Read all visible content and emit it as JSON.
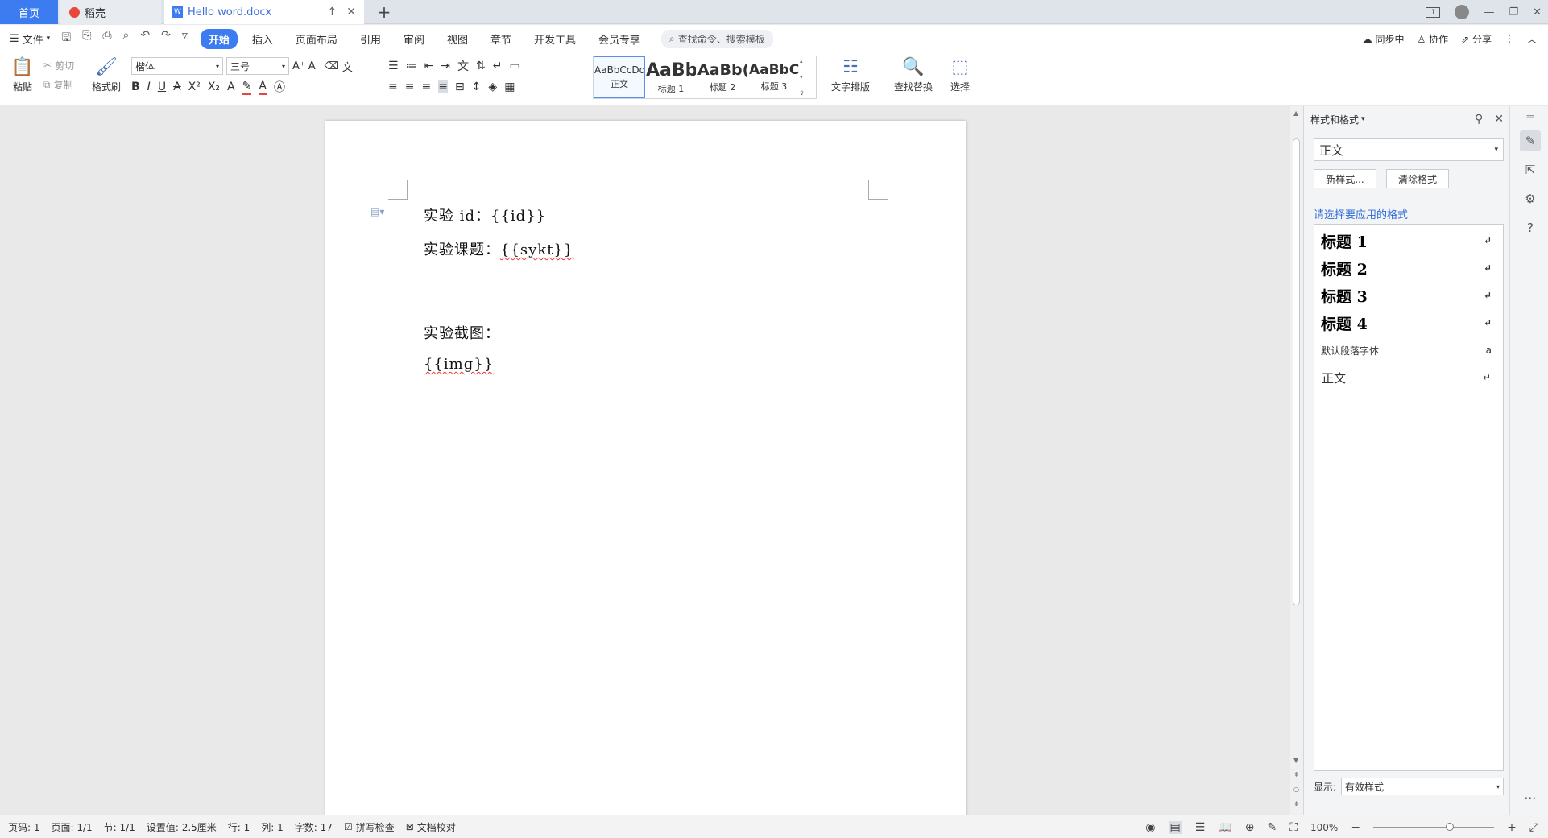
{
  "tabs": {
    "home": "首页",
    "daoke": "稻壳",
    "doc": "Hello word.docx",
    "add": "+"
  },
  "menubar": {
    "file": "文件",
    "tabs": [
      "开始",
      "插入",
      "页面布局",
      "引用",
      "审阅",
      "视图",
      "章节",
      "开发工具",
      "会员专享"
    ],
    "active_tab": "开始",
    "search": "查找命令、搜索模板",
    "sync": "同步中",
    "collab": "协作",
    "share": "分享"
  },
  "ribbon": {
    "paste": "粘贴",
    "cut": "剪切",
    "copy": "复制",
    "format_painter": "格式刷",
    "font_name": "楷体",
    "font_size": "三号",
    "styles": [
      {
        "preview": "AaBbCcDd",
        "label": "正文"
      },
      {
        "preview": "AaBb",
        "label": "标题 1"
      },
      {
        "preview": "AaBb(",
        "label": "标题 2"
      },
      {
        "preview": "AaBbC(",
        "label": "标题 3"
      }
    ],
    "text_layout": "文字排版",
    "find_replace": "查找替换",
    "select": "选择"
  },
  "document": {
    "lines": [
      "实验 id：{{id}}",
      "实验课题：{{sykt}}",
      "实验截图：",
      "{{img}}"
    ],
    "line1_prefix": "实验 id：",
    "line1_var": "{{id}}",
    "line2_prefix": "实验课题：",
    "line2_var": "{{sykt}}",
    "line3": "实验截图：",
    "line4": "{{img}}"
  },
  "stylepane": {
    "title": "样式和格式",
    "current_style": "正文",
    "new_style": "新样式...",
    "clear_format": "清除格式",
    "prompt": "请选择要应用的格式",
    "items": [
      "标题 1",
      "标题 2",
      "标题 3",
      "标题 4",
      "默认段落字体",
      "正文"
    ],
    "show_label": "显示:",
    "show_value": "有效样式"
  },
  "statusbar": {
    "page_num": "页码: 1",
    "pages": "页面: 1/1",
    "section": "节: 1/1",
    "setting": "设置值: 2.5厘米",
    "row": "行: 1",
    "col": "列: 1",
    "words": "字数: 17",
    "spell": "拼写检查",
    "proof": "文档校对",
    "zoom": "100%"
  },
  "colors": {
    "accent": "#3c7cf0",
    "link": "#2f6bd8",
    "spell_error": "#e33333"
  }
}
